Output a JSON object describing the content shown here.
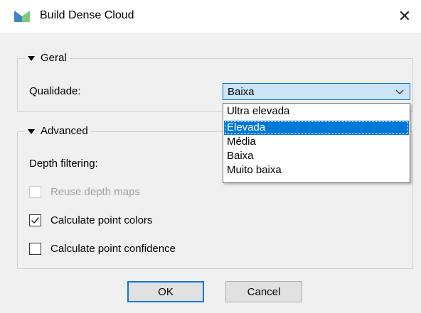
{
  "window": {
    "title": "Build Dense Cloud",
    "close_glyph": "✕",
    "app_icon": "metashape-icon"
  },
  "general": {
    "header": "Geral",
    "quality_label": "Qualidade:",
    "quality_value": "Baixa",
    "quality_options": [
      "Ultra elevada",
      "Elevada",
      "Média",
      "Baixa",
      "Muito baixa"
    ],
    "highlighted_option": "Elevada"
  },
  "advanced": {
    "header": "Advanced",
    "depth_filtering_label": "Depth filtering:",
    "reuse_depth_maps": {
      "label": "Reuse depth maps",
      "checked": false,
      "enabled": false
    },
    "calculate_point_colors": {
      "label": "Calculate point colors",
      "checked": true,
      "enabled": true
    },
    "calculate_point_confidence": {
      "label": "Calculate point confidence",
      "checked": false,
      "enabled": true
    }
  },
  "buttons": {
    "ok": "OK",
    "cancel": "Cancel"
  },
  "colors": {
    "accent": "#0078d7",
    "combo_bg": "#cce4f7",
    "dialog_bg": "#f0f0f0"
  }
}
